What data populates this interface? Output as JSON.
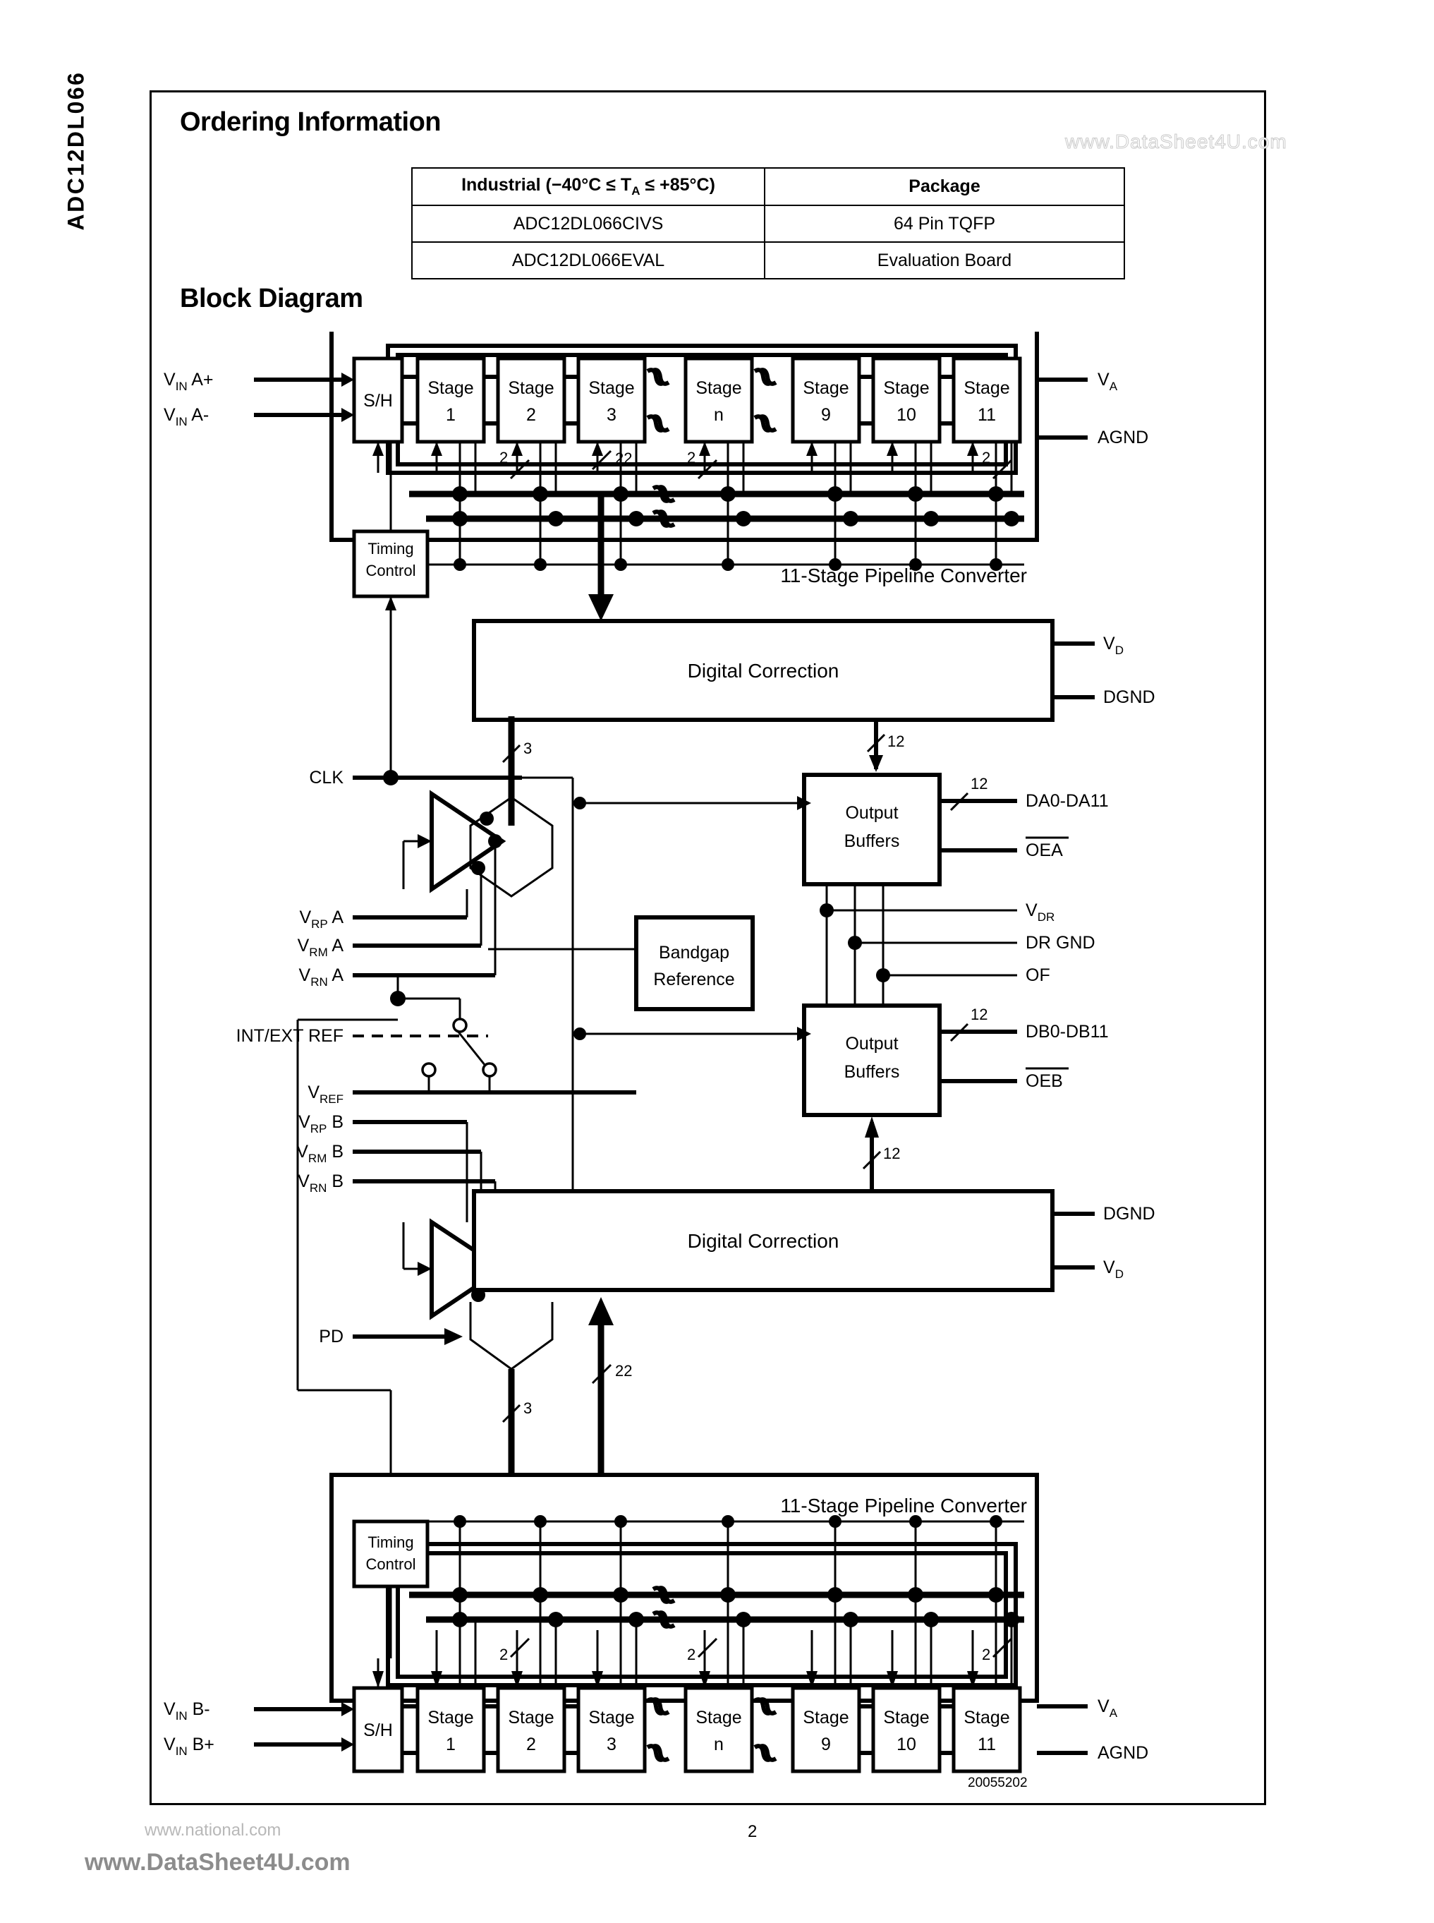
{
  "page": {
    "side_title": "ADC12DL066",
    "page_number": "2",
    "figure_number": "20055202",
    "watermark_top": "www.DataSheet4U.com",
    "watermark_bottom": "www.DataSheet4U.com",
    "watermark_national": "www.national.com"
  },
  "headings": {
    "ordering": "Ordering Information",
    "block_diagram": "Block Diagram"
  },
  "ordering_table": {
    "header": {
      "col1_pre": "Industrial (−40°C ≤ T",
      "col1_sub": "A",
      "col1_post": " ≤ +85°C)",
      "col2": "Package"
    },
    "rows": [
      {
        "part": "ADC12DL066CIVS",
        "package": "64 Pin TQFP"
      },
      {
        "part": "ADC12DL066EVAL",
        "package": "Evaluation Board"
      }
    ]
  },
  "diagram": {
    "channel_a": {
      "inputs": [
        {
          "v": "V",
          "sub": "IN",
          "post": " A+"
        },
        {
          "v": "V",
          "sub": "IN",
          "post": " A-"
        }
      ],
      "sh": "S/H",
      "timing": {
        "line1": "Timing",
        "line2": "Control"
      },
      "stages": [
        "Stage\n1",
        "Stage\n2",
        "Stage\n3",
        "Stage\nn",
        "Stage\n9",
        "Stage\n10",
        "Stage\n11"
      ],
      "stage_labels": [
        {
          "t": "Stage",
          "n": "1"
        },
        {
          "t": "Stage",
          "n": "2"
        },
        {
          "t": "Stage",
          "n": "3"
        },
        {
          "t": "Stage",
          "n": "n"
        },
        {
          "t": "Stage",
          "n": "9"
        },
        {
          "t": "Stage",
          "n": "10"
        },
        {
          "t": "Stage",
          "n": "11"
        }
      ],
      "pipeline_label": "11-Stage Pipeline Converter",
      "bus_22": "22",
      "bus_2": "2",
      "power": [
        {
          "v": "V",
          "sub": "A"
        }
      ],
      "gnd": "AGND"
    },
    "channel_b": {
      "inputs": [
        {
          "v": "V",
          "sub": "IN",
          "post": " B-"
        },
        {
          "v": "V",
          "sub": "IN",
          "post": " B+"
        }
      ],
      "sh": "S/H",
      "timing": {
        "line1": "Timing",
        "line2": "Control"
      },
      "stage_labels": [
        {
          "t": "Stage",
          "n": "1"
        },
        {
          "t": "Stage",
          "n": "2"
        },
        {
          "t": "Stage",
          "n": "3"
        },
        {
          "t": "Stage",
          "n": "n"
        },
        {
          "t": "Stage",
          "n": "9"
        },
        {
          "t": "Stage",
          "n": "10"
        },
        {
          "t": "Stage",
          "n": "11"
        }
      ],
      "pipeline_label": "11-Stage Pipeline Converter",
      "bus_22": "22",
      "bus_2": "2",
      "power": [
        {
          "v": "V",
          "sub": "A"
        }
      ],
      "gnd": "AGND"
    },
    "digital_correction_top": {
      "label": "Digital Correction",
      "pins": [
        {
          "v": "V",
          "sub": "D"
        },
        {
          "plain": "DGND"
        }
      ],
      "bus_out": "12"
    },
    "digital_correction_bottom": {
      "label": "Digital Correction",
      "pins": [
        {
          "plain": "DGND"
        },
        {
          "v": "V",
          "sub": "D"
        }
      ],
      "bus_out": "12"
    },
    "output_buffers_a": {
      "line1": "Output",
      "line2": "Buffers",
      "bus": "12",
      "data_pins": "DA0-DA11",
      "oe": "OEA"
    },
    "output_buffers_b": {
      "line1": "Output",
      "line2": "Buffers",
      "bus": "12",
      "data_pins": "DB0-DB11",
      "oe": "OEB"
    },
    "shared_pins": [
      {
        "v": "V",
        "sub": "DR"
      },
      {
        "plain": "DR GND"
      },
      {
        "plain": "OF"
      }
    ],
    "bandgap": {
      "line1": "Bandgap",
      "line2": "Reference"
    },
    "clk_label": "CLK",
    "pd_label": "PD",
    "bus_3": "3",
    "int_ext_ref": "INT/EXT REF",
    "ref_pins_a": [
      {
        "v": "V",
        "sub": "RP",
        "post": " A"
      },
      {
        "v": "V",
        "sub": "RM",
        "post": " A"
      },
      {
        "v": "V",
        "sub": "RN",
        "post": " A"
      }
    ],
    "vref": {
      "v": "V",
      "sub": "REF"
    },
    "ref_pins_b": [
      {
        "v": "V",
        "sub": "RP",
        "post": " B"
      },
      {
        "v": "V",
        "sub": "RM",
        "post": " B"
      },
      {
        "v": "V",
        "sub": "RN",
        "post": " B"
      }
    ]
  }
}
